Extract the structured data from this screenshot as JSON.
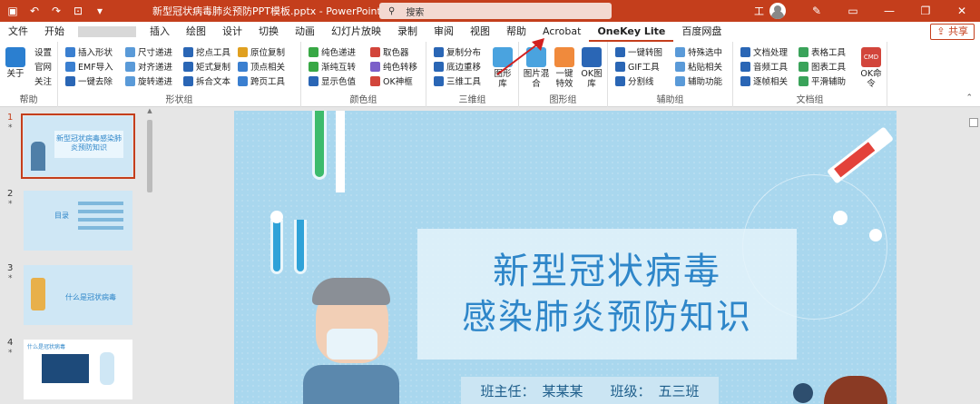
{
  "window": {
    "doc_title": "新型冠状病毒肺炎预防PPT模板.pptx - PowerPoint",
    "search_placeholder": "搜索",
    "user_initial": "工"
  },
  "tabs": [
    "文件",
    "开始",
    "插入",
    "绘图",
    "设计",
    "切换",
    "动画",
    "幻灯片放映",
    "录制",
    "审阅",
    "视图",
    "帮助",
    "Acrobat",
    "OneKey Lite",
    "百度网盘"
  ],
  "share_label": "共享",
  "ribbon": {
    "help_group": {
      "label": "帮助",
      "about": "关于",
      "settings": "设置",
      "website": "官网",
      "follow": "关注"
    },
    "shape_group": {
      "label": "形状组",
      "items": [
        "插入形状",
        "尺寸递进",
        "挖点工具",
        "原位复制",
        "EMF导入",
        "对齐递进",
        "矩式复制",
        "顶点相关",
        "一键去除",
        "旋转递进",
        "拆合文本",
        "跨页工具"
      ]
    },
    "color_group": {
      "label": "颜色组",
      "items": [
        "纯色递进",
        "取色器",
        "渐纯互转",
        "纯色转移",
        "显示色值",
        "OK神框"
      ]
    },
    "threed_group": {
      "label": "三维组",
      "items": [
        "复制分布",
        "底边重移",
        "三维工具"
      ],
      "big": "图形库"
    },
    "image_group": {
      "label": "图形组",
      "big": [
        "图片混合",
        "一键特效",
        "OK图库"
      ]
    },
    "assist_group": {
      "label": "辅助组",
      "items": [
        "一键转图",
        "特殊选中",
        "GIF工具",
        "粘贴相关",
        "分割线",
        "辅助功能"
      ]
    },
    "doc_group": {
      "label": "文档组",
      "items": [
        "文档处理",
        "表格工具",
        "音频工具",
        "图表工具",
        "逐帧相关",
        "平滑辅助"
      ],
      "big": "OK命令",
      "cmd": "CMD"
    }
  },
  "slides": [
    {
      "number": "1",
      "star": "*",
      "title": "新型冠状病毒感染肺炎预防知识"
    },
    {
      "number": "2",
      "star": "*",
      "title": "目录"
    },
    {
      "number": "3",
      "star": "*",
      "title": "什么是冠状病毒"
    },
    {
      "number": "4",
      "star": "*",
      "title": "什么是冠状病毒"
    }
  ],
  "main_slide": {
    "title_line1": "新型冠状病毒",
    "title_line2": "感染肺炎预防知识",
    "teacher_label": "班主任：",
    "teacher_name": "某某某",
    "class_label": "班级：",
    "class_name": "五三班"
  },
  "colors": {
    "accent": "#c43e1c",
    "slide_bg": "#a9d7ee",
    "title_text": "#2e86c9"
  }
}
